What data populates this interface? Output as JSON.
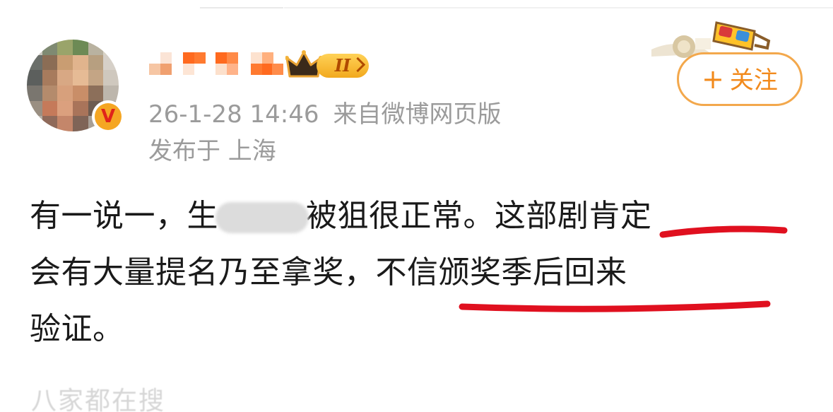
{
  "user": {
    "vip_level": "II",
    "verified_mark": "V"
  },
  "meta": {
    "timestamp": "26-1-28 14:46",
    "source": "来自微博网页版",
    "location": "发布于 上海"
  },
  "actions": {
    "follow_plus": "+",
    "follow_label": "关注"
  },
  "post": {
    "line1_a": "有一说一，生",
    "line1_b": "被狙很正常。这部剧肯定",
    "line2": "会有大量提名乃至拿奖，不信颁奖季后回来",
    "line3": "验证。"
  },
  "footer": {
    "faded_text": "八家都在搜"
  },
  "colors": {
    "accent_orange": "#f28a1c",
    "annotation_red": "#e0101f",
    "meta_gray": "#9b9b9b",
    "text": "#1a1a1a"
  },
  "icons": [
    "avatar",
    "verified-v-icon",
    "crown-icon",
    "vip-badge-icon",
    "3d-glasses-decoration-icon",
    "plus-icon"
  ]
}
